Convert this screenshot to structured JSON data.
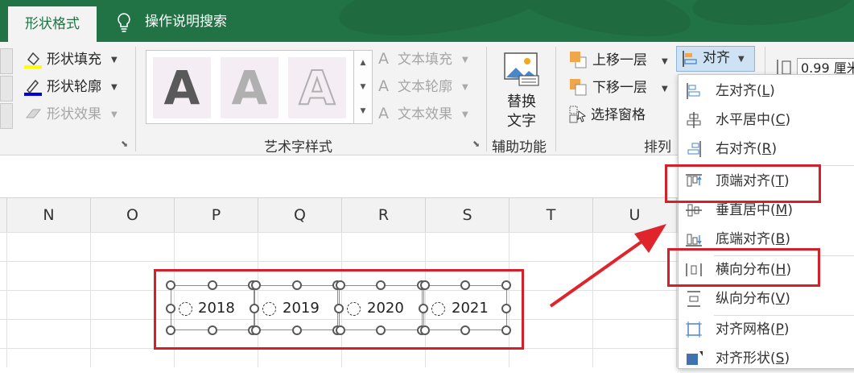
{
  "tabs": {
    "active": "形状格式",
    "tell_me": "操作说明搜索"
  },
  "shape_styles": {
    "fill": "形状填充",
    "outline": "形状轮廓",
    "effects": "形状效果"
  },
  "wordart": {
    "tile_letter": "A",
    "text_fill": "文本填充",
    "text_outline": "文本轮廓",
    "text_effects": "文本效果",
    "group_label": "艺术字样式"
  },
  "accessibility": {
    "button_line1": "替换",
    "button_line2": "文字",
    "group_label": "辅助功能"
  },
  "arrange": {
    "bring_forward": "上移一层",
    "send_backward": "下移一层",
    "selection_pane": "选择窗格",
    "align": "对齐",
    "group_label": "排列"
  },
  "size": {
    "height_value": "0.99 厘米",
    "width_suffix": "厘米"
  },
  "columns": [
    "N",
    "O",
    "P",
    "Q",
    "R",
    "S",
    "T",
    "U"
  ],
  "shapes": [
    "2018",
    "2019",
    "2020",
    "2021"
  ],
  "align_menu": [
    {
      "label": "左对齐",
      "key": "L"
    },
    {
      "label": "水平居中",
      "key": "C"
    },
    {
      "label": "右对齐",
      "key": "R"
    },
    {
      "label": "顶端对齐",
      "key": "T"
    },
    {
      "label": "垂直居中",
      "key": "M"
    },
    {
      "label": "底端对齐",
      "key": "B"
    },
    {
      "label": "横向分布",
      "key": "H"
    },
    {
      "label": "纵向分布",
      "key": "V"
    },
    {
      "label": "对齐网格",
      "key": "P"
    },
    {
      "label": "对齐形状",
      "key": "S"
    }
  ],
  "colors": {
    "excel_green": "#217346",
    "highlight_red": "#d4202a",
    "selected_blue": "#cfe2f3"
  }
}
